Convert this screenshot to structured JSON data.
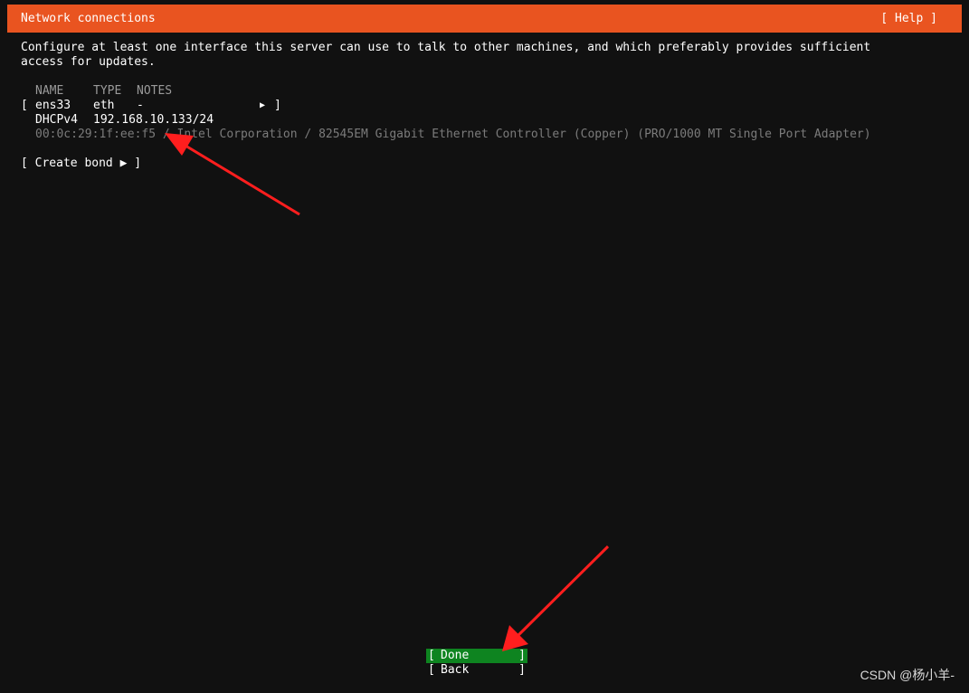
{
  "header": {
    "title": "Network connections",
    "help_label": "[ Help ]"
  },
  "description": {
    "line1": "Configure at least one interface this server can use to talk to other machines, and which preferably provides sufficient",
    "line2": "access for updates."
  },
  "table": {
    "columns": [
      "NAME",
      "TYPE",
      "NOTES"
    ],
    "interfaces": [
      {
        "open_bracket": "[",
        "name": "ens33",
        "type": "eth",
        "notes": "-",
        "expand_arrow": "▶",
        "close_bracket": "]",
        "dhcp_label": "DHCPv4",
        "address": "192.168.10.133/24",
        "mac_info": "00:0c:29:1f:ee:f5 / Intel Corporation / 82545EM Gigabit Ethernet Controller (Copper) (PRO/1000 MT Single Port Adapter)"
      }
    ]
  },
  "create_bond_label": "[ Create bond ▶ ]",
  "buttons": {
    "done": {
      "open": "[",
      "label": "Done",
      "close": "]"
    },
    "back": {
      "open": "[",
      "label": "Back",
      "close": "]"
    }
  },
  "watermark": "CSDN @杨小羊-",
  "colors": {
    "header_bg": "#e95420",
    "background": "#111111",
    "done_bg": "#0e8420",
    "arrow": "#ff1e1e"
  },
  "icons": {
    "expand": "triangle-right-icon",
    "annotation": "red-arrow-icon"
  }
}
